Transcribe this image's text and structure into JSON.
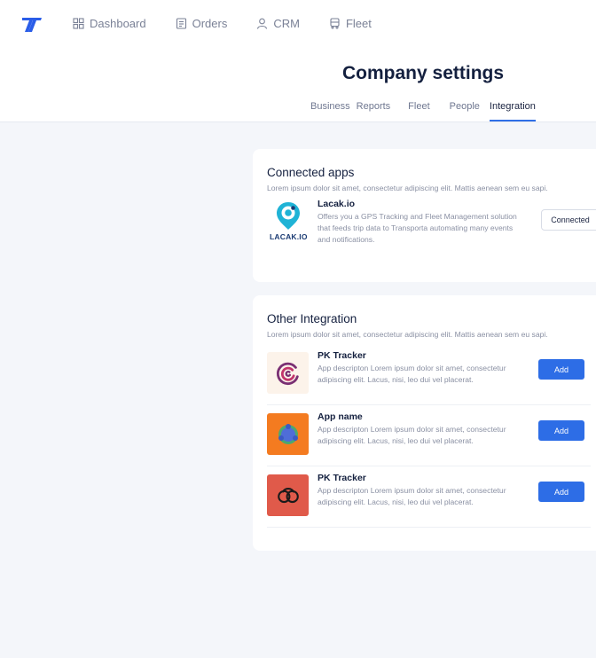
{
  "nav": {
    "items": [
      {
        "label": "Dashboard",
        "icon": "dashboard-icon"
      },
      {
        "label": "Orders",
        "icon": "orders-icon"
      },
      {
        "label": "CRM",
        "icon": "user-icon"
      },
      {
        "label": "Fleet",
        "icon": "truck-icon"
      }
    ]
  },
  "page": {
    "title": "Company settings",
    "tabs": [
      "Business",
      "Reports",
      "Fleet",
      "People",
      "Integration"
    ],
    "active_tab": "Integration"
  },
  "connected_apps": {
    "title": "Connected apps",
    "description": "Lorem ipsum dolor sit amet, consectetur adipiscing elit. Mattis aenean sem eu sapi.",
    "app": {
      "name": "Lacak.io",
      "logo_text": "LACAK.IO",
      "description": "Offers you a GPS Tracking and Fleet Management solution that feeds trip data to Transporta automating many events and notifications.",
      "button": "Connected"
    }
  },
  "other_integration": {
    "title": "Other Integration",
    "description": "Lorem ipsum dolor sit amet, consectetur adipiscing elit. Mattis aenean sem eu sapi.",
    "apps": [
      {
        "name": "PK Tracker",
        "description": "App descripton Lorem ipsum dolor sit amet, consectetur adipiscing elit. Lacus, nisi, leo dui vel placerat.",
        "button": "Add",
        "icon": "pk-tracker-spiral-icon"
      },
      {
        "name": "App name",
        "description": "App descripton Lorem ipsum dolor sit amet, consectetur adipiscing elit. Lacus, nisi, leo dui vel placerat.",
        "button": "Add",
        "icon": "app-orbit-icon"
      },
      {
        "name": "PK Tracker",
        "description": "App descripton Lorem ipsum dolor sit amet, consectetur adipiscing elit. Lacus, nisi, leo dui vel placerat.",
        "button": "Add",
        "icon": "pk-tracker-rings-icon"
      }
    ]
  },
  "colors": {
    "accent": "#2d6de6",
    "brand_logo": "#2a5de8",
    "page_bg": "#f4f6fa",
    "title": "#14203f"
  }
}
